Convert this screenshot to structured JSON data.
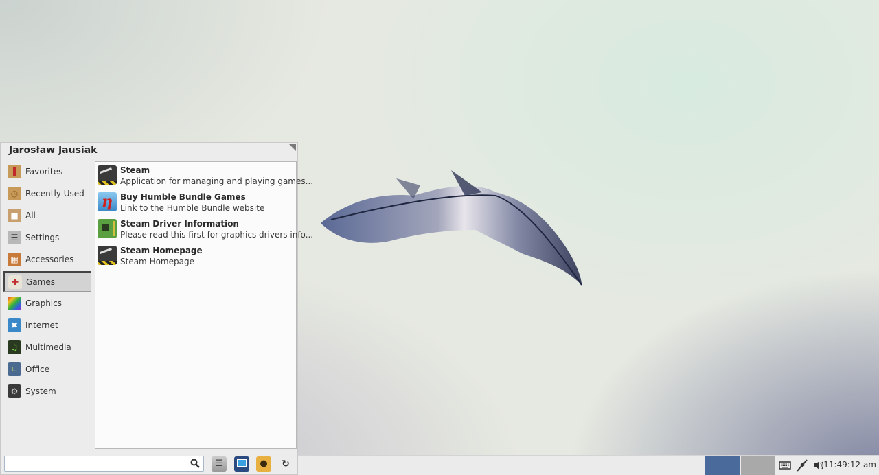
{
  "desktop": {
    "wallpaper": "feather"
  },
  "menu": {
    "user_name": "Jarosław Jausiak",
    "categories": [
      {
        "label": "Favorites",
        "icon": "favorites-icon",
        "active": false
      },
      {
        "label": "Recently Used",
        "icon": "recently-used-icon",
        "active": false
      },
      {
        "label": "All",
        "icon": "all-icon",
        "active": false
      },
      {
        "label": "Settings",
        "icon": "settings-icon",
        "active": false
      },
      {
        "label": "Accessories",
        "icon": "accessories-icon",
        "active": false
      },
      {
        "label": "Games",
        "icon": "games-icon",
        "active": true
      },
      {
        "label": "Graphics",
        "icon": "graphics-icon",
        "active": false
      },
      {
        "label": "Internet",
        "icon": "internet-icon",
        "active": false
      },
      {
        "label": "Multimedia",
        "icon": "multimedia-icon",
        "active": false
      },
      {
        "label": "Office",
        "icon": "office-icon",
        "active": false
      },
      {
        "label": "System",
        "icon": "system-icon",
        "active": false
      }
    ],
    "apps": [
      {
        "name": "Steam",
        "description": "Application for managing and playing games...",
        "icon": "steam-icon"
      },
      {
        "name": "Buy Humble Bundle Games",
        "description": "Link to the Humble Bundle website",
        "icon": "humble-bundle-icon"
      },
      {
        "name": "Steam Driver Information",
        "description": "Please read this first for graphics drivers info...",
        "icon": "driver-info-icon"
      },
      {
        "name": "Steam Homepage",
        "description": "Steam Homepage",
        "icon": "steam-icon"
      }
    ],
    "search": {
      "value": "",
      "placeholder": ""
    },
    "actions": [
      {
        "name": "settings-manager-button",
        "icon": "settings-manager-icon"
      },
      {
        "name": "lock-screen-button",
        "icon": "lock-screen-icon"
      },
      {
        "name": "switch-user-button",
        "icon": "switch-user-icon"
      },
      {
        "name": "logout-button",
        "icon": "power-icon"
      }
    ]
  },
  "taskbar": {
    "workspaces": [
      {
        "number": 1,
        "active": true,
        "color": "#4a6a9c"
      },
      {
        "number": 2,
        "active": false,
        "color": "#a9a9a9"
      }
    ],
    "tray": [
      "keyboard-icon",
      "network-icon",
      "volume-icon"
    ],
    "clock": "11:49:12 am"
  }
}
